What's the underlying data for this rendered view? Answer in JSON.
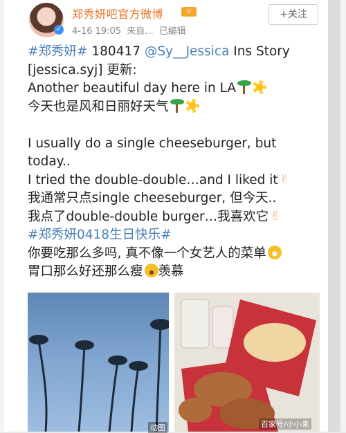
{
  "post": {
    "author": "郑秀妍吧官方微博",
    "date": "4-16 19:05",
    "source": "来自...",
    "edited": "已编辑",
    "follow_label": "+关注",
    "lines": [
      {
        "tag": "#郑秀妍#",
        "text": " 180417 ",
        "mention": "@Sy__Jessica",
        "tail": " Ins Story"
      },
      {
        "text": "[jessica.syj] 更新:"
      },
      {
        "text": "Another beautiful day here in LA",
        "emojis": [
          "palm-tree-icon",
          "sun-icon"
        ]
      },
      {
        "text": "今天也是风和日丽好天气",
        "emojis": [
          "palm-tree-icon",
          "sun-icon"
        ]
      },
      {
        "text": ""
      },
      {
        "text": "I usually do a single cheeseburger, but"
      },
      {
        "text": "today.."
      },
      {
        "text": "I tried the double-double…and I liked it",
        "emojis": [
          "peace-hand-icon"
        ]
      },
      {
        "text": "我通常只点single cheeseburger, 但今天.."
      },
      {
        "text": "我点了double-double burger…我喜欢它",
        "emojis": [
          "peace-hand-icon"
        ]
      },
      {
        "tag": "#郑秀妍0418生日快乐#"
      },
      {
        "text": "你要吃那么多吗, 真不像一个女艺人的菜单",
        "emojis": [
          "laugh-icon"
        ]
      },
      {
        "text": "胃口那么好还那么瘦",
        "emojis": [
          "cry-icon"
        ],
        "tail": "羡慕"
      }
    ]
  },
  "images": {
    "gif_badge": "动图",
    "watermark": "百家号/小小来"
  },
  "colors": {
    "name": "#e8762d",
    "link": "#4a7fb8",
    "meta": "#888888"
  }
}
